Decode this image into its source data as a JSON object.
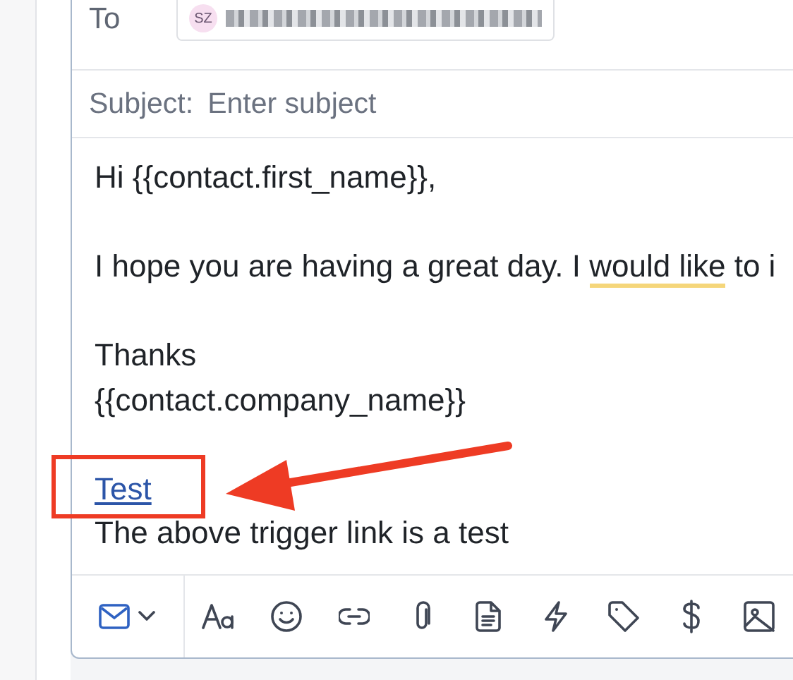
{
  "to": {
    "label": "To",
    "recipients": [
      {
        "initials": "SZ"
      }
    ]
  },
  "subject": {
    "label": "Subject:",
    "placeholder": "Enter subject"
  },
  "body": [
    {
      "kind": "text",
      "parts": [
        {
          "text": "Hi {{contact.first_name}},",
          "flagged": false
        }
      ]
    },
    {
      "kind": "blank"
    },
    {
      "kind": "text",
      "parts": [
        {
          "text": "I hope you are having a great day. I ",
          "flagged": false
        },
        {
          "text": "would like",
          "flagged": true
        },
        {
          "text": " to i",
          "flagged": false
        }
      ]
    },
    {
      "kind": "blank"
    },
    {
      "kind": "text",
      "parts": [
        {
          "text": "Thanks",
          "flagged": false
        }
      ]
    },
    {
      "kind": "text",
      "parts": [
        {
          "text": "{{contact.company_name}}",
          "flagged": false
        }
      ]
    },
    {
      "kind": "blank"
    },
    {
      "kind": "link",
      "parts": [
        {
          "text": "Test",
          "flagged": false
        }
      ]
    },
    {
      "kind": "text",
      "parts": [
        {
          "text": "The above trigger link is a test",
          "flagged": false
        }
      ]
    }
  ],
  "annotations": {
    "highlight_box": true,
    "arrow": true
  },
  "toolbar": [
    {
      "kind": "mail"
    },
    {
      "kind": "font"
    },
    {
      "kind": "emoji"
    },
    {
      "kind": "link"
    },
    {
      "kind": "attach"
    },
    {
      "kind": "document"
    },
    {
      "kind": "bolt"
    },
    {
      "kind": "tag"
    },
    {
      "kind": "dollar"
    },
    {
      "kind": "image"
    }
  ]
}
